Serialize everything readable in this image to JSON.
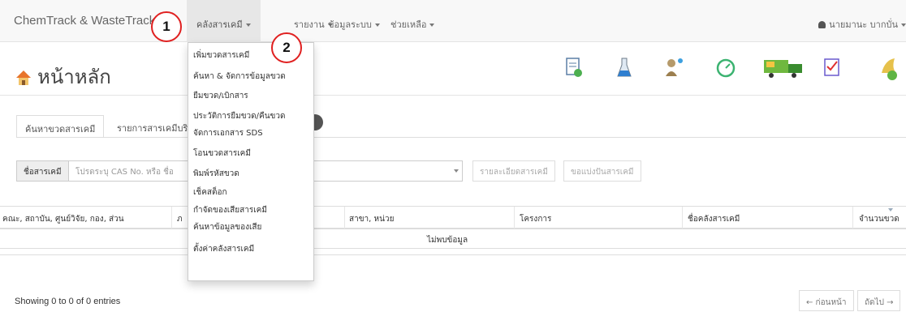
{
  "navbar": {
    "brand": "ChemTrack & WasteTrack",
    "menu": [
      {
        "label": "คลังสารเคมี"
      },
      {
        "label": "รายงาน"
      },
      {
        "label": "ข้อมูลระบบ"
      },
      {
        "label": "ช่วยเหลือ"
      }
    ],
    "user": "นายมานะ บากบั่น"
  },
  "callouts": [
    "1",
    "2"
  ],
  "dropdown_items": [
    "เพิ่มขวดสารเคมี",
    "ค้นหา & จัดการข้อมูลขวด",
    "ยืมขวด/เบิกสาร",
    "ประวัติการยืมขวด/คืนขวด",
    "จัดการเอกสาร SDS",
    "โอนขวดสารเคมี",
    "พิมพ์รหัสขวด",
    "เช็คสต็อก",
    "กำจัดของเสียสารเคมี",
    "ค้นหาข้อมูลของเสีย",
    "ตั้งค่าคลังสารเคมี"
  ],
  "page": {
    "title": "หน้าหลัก"
  },
  "toolbar_icons": [
    "document-icon",
    "flask-icon",
    "people-icon",
    "timer-icon",
    "truck-icon",
    "checklist-icon",
    "badge-icon"
  ],
  "tabs": [
    {
      "label": "ค้นหาขวดสารเคมี"
    },
    {
      "label": "รายการสารเคมีบริ"
    }
  ],
  "search": {
    "addon": "ชื่อสารเคมี",
    "placeholder": "โปรดระบุ CAS No. หรือ ชื่อ",
    "detail_button": "รายละเอียดสารเคมี",
    "share_button": "ขอแบ่งปันสารเคมี"
  },
  "table": {
    "headers": [
      "คณะ, สถาบัน, ศูนย์วิจัย, กอง, ส่วน",
      "ภ",
      "สาขา, หน่วย",
      "โครงการ",
      "ชื่อคลังสารเคมี",
      "จำนวนขวด"
    ],
    "empty": "ไม่พบข้อมูล"
  },
  "footer": {
    "info": "Showing 0 to 0 of 0 entries",
    "prev": "← ก่อนหน้า",
    "next": "ถัดไป →"
  }
}
